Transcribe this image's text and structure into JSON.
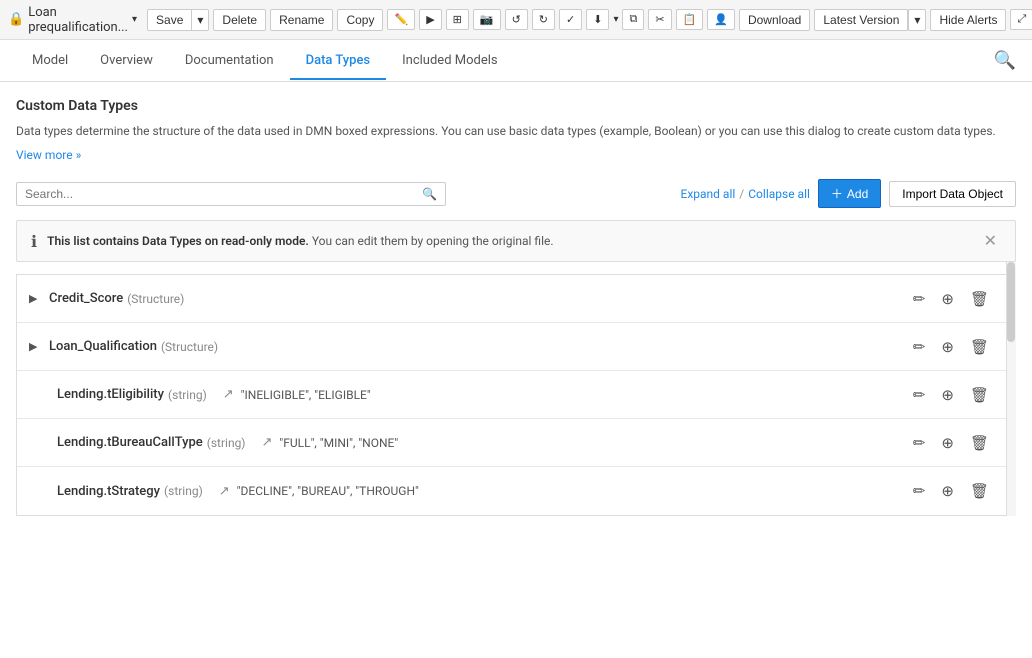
{
  "toolbar": {
    "title": "Loan prequalification...",
    "save_label": "Save",
    "delete_label": "Delete",
    "rename_label": "Rename",
    "copy_label": "Copy",
    "download_label": "Download",
    "latest_version_label": "Latest Version",
    "hide_alerts_label": "Hide Alerts"
  },
  "nav": {
    "tabs": [
      {
        "id": "model",
        "label": "Model"
      },
      {
        "id": "overview",
        "label": "Overview"
      },
      {
        "id": "documentation",
        "label": "Documentation"
      },
      {
        "id": "data-types",
        "label": "Data Types"
      },
      {
        "id": "included-models",
        "label": "Included Models"
      }
    ],
    "active": "data-types"
  },
  "main": {
    "title": "Custom Data Types",
    "description": "Data types determine the structure of the data used in DMN boxed expressions. You can use basic data types (example, Boolean) or you can use this dialog to create custom data types.",
    "view_more": "View more »",
    "search_placeholder": "Search...",
    "expand_all": "Expand all",
    "collapse_all": "Collapse all",
    "add_label": "Add",
    "import_label": "Import Data Object",
    "info_banner": {
      "text_bold": "This list contains Data Types on read-only mode.",
      "text_rest": " You can edit them by opening the original file."
    },
    "data_types": [
      {
        "id": "credit-score",
        "name": "Credit_Score",
        "type": "(Structure)",
        "expandable": true,
        "indent": false,
        "constraint_icon": "",
        "constraint": ""
      },
      {
        "id": "loan-qualification",
        "name": "Loan_Qualification",
        "type": "(Structure)",
        "expandable": true,
        "indent": false,
        "constraint_icon": "",
        "constraint": ""
      },
      {
        "id": "lending-teligibility",
        "name": "Lending.tEligibility",
        "type": "(string)",
        "expandable": false,
        "indent": true,
        "constraint_icon": "↗",
        "constraint": "\"INELIGIBLE\", \"ELIGIBLE\""
      },
      {
        "id": "lending-tbureaucalltype",
        "name": "Lending.tBureauCallType",
        "type": "(string)",
        "expandable": false,
        "indent": true,
        "constraint_icon": "↗",
        "constraint": "\"FULL\", \"MINI\", \"NONE\""
      },
      {
        "id": "lending-tstrategy",
        "name": "Lending.tStrategy",
        "type": "(string)",
        "expandable": false,
        "indent": true,
        "constraint_icon": "↗",
        "constraint": "\"DECLINE\", \"BUREAU\", \"THROUGH\""
      }
    ]
  }
}
